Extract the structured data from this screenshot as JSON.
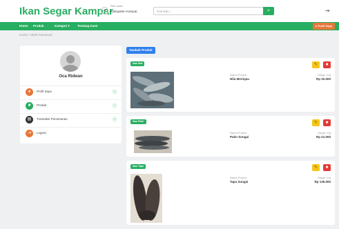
{
  "header": {
    "brand": "Ikan Segar Kampar",
    "location_label": "Pilih Lokasi",
    "location_value": "Kabupaten Kampar,",
    "search_placeholder": "Cari ikan..."
  },
  "navbar": {
    "items": [
      "Home",
      "Produk",
      "Kategori ▾",
      "Tentang Kami"
    ],
    "profile_button": "Profil Saya"
  },
  "breadcrumb": "Home  /  Ubah Password",
  "sidebar": {
    "user_name": "Oca Ridwan",
    "items": [
      {
        "label": "Profil Saya",
        "color": "#e8763a"
      },
      {
        "label": "Produk",
        "color": "#27ae60"
      },
      {
        "label": "Transaksi Pemesanan",
        "color": "#333333"
      },
      {
        "label": "Logout",
        "color": "#e8763a"
      }
    ]
  },
  "main": {
    "add_button": "Tambah Produk",
    "name_label": "Nama Produk",
    "price_label": "Harga / Kg",
    "products": [
      {
        "category": "Ikan Nila",
        "name": "Nila Merinjau",
        "price": "Rp 32.000"
      },
      {
        "category": "Ikan Patin",
        "name": "Patin Sungai",
        "price": "Rp 21.000"
      },
      {
        "category": "Ikan Tapa",
        "name": "Tapa Sungai",
        "price": "Rp 135.000"
      }
    ]
  },
  "colors": {
    "brand_green": "#27ae60",
    "accent_orange": "#e8763a",
    "primary_blue": "#2f80ed",
    "edit_yellow": "#f5c518",
    "delete_red": "#e53935"
  }
}
